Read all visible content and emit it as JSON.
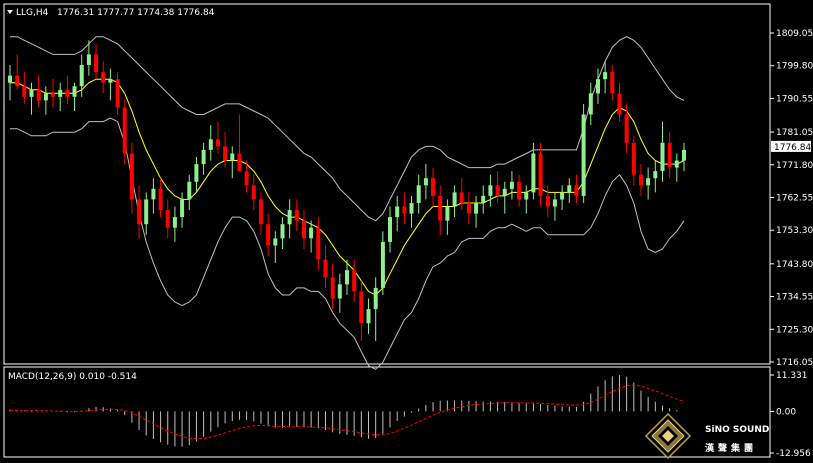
{
  "header": {
    "symbol_text": "LLG,H4",
    "ohlc_text": "1776.31 1777.77 1774.38 1776.84"
  },
  "macd": {
    "label": "MACD(12,26,9) 0.010 -0.514",
    "axis_labels": [
      "11.331",
      "0.00",
      "-12.956"
    ]
  },
  "logo": {
    "en": "SiNO SOUND",
    "cn": "漢聲集團"
  },
  "colors": {
    "background": "#000000",
    "frame": "#ffffff",
    "bull": "#90ee90",
    "bear": "#ff0000",
    "ma": "#ffff00",
    "bands": "#c0c0c0",
    "signal": "#ff0000",
    "hist": "#c0c0c0"
  },
  "chart_data": {
    "type": "candlestick",
    "y_ticks": [
      1809.05,
      1799.8,
      1790.55,
      1781.05,
      1771.8,
      1762.55,
      1753.3,
      1743.8,
      1734.55,
      1725.3,
      1716.05
    ],
    "current_price": 1776.84,
    "ylim": [
      1716.05,
      1809.05
    ],
    "candles": [
      [
        1795,
        1800,
        1790,
        1797
      ],
      [
        1797,
        1803,
        1793,
        1794
      ],
      [
        1794,
        1798,
        1789,
        1791
      ],
      [
        1791,
        1795,
        1786,
        1793
      ],
      [
        1793,
        1797,
        1788,
        1790
      ],
      [
        1790,
        1794,
        1786,
        1792
      ],
      [
        1792,
        1796,
        1788,
        1791
      ],
      [
        1791,
        1795,
        1787,
        1793
      ],
      [
        1793,
        1797,
        1789,
        1791
      ],
      [
        1791,
        1795,
        1787,
        1794
      ],
      [
        1794,
        1803,
        1791,
        1800
      ],
      [
        1800,
        1807,
        1797,
        1803
      ],
      [
        1803,
        1806,
        1796,
        1798
      ],
      [
        1798,
        1801,
        1792,
        1795
      ],
      [
        1795,
        1799,
        1790,
        1796
      ],
      [
        1796,
        1798,
        1786,
        1788
      ],
      [
        1788,
        1790,
        1772,
        1775
      ],
      [
        1775,
        1778,
        1758,
        1762
      ],
      [
        1762,
        1766,
        1751,
        1755
      ],
      [
        1755,
        1764,
        1752,
        1762
      ],
      [
        1762,
        1768,
        1758,
        1765
      ],
      [
        1765,
        1768,
        1757,
        1759
      ],
      [
        1759,
        1762,
        1751,
        1754
      ],
      [
        1754,
        1760,
        1750,
        1757
      ],
      [
        1757,
        1764,
        1754,
        1762
      ],
      [
        1762,
        1769,
        1759,
        1767
      ],
      [
        1767,
        1774,
        1764,
        1772
      ],
      [
        1772,
        1778,
        1769,
        1776
      ],
      [
        1776,
        1783,
        1773,
        1779
      ],
      [
        1779,
        1784,
        1775,
        1777
      ],
      [
        1777,
        1781,
        1771,
        1773
      ],
      [
        1773,
        1777,
        1768,
        1775
      ],
      [
        1775,
        1786,
        1772,
        1770
      ],
      [
        1770,
        1773,
        1764,
        1766
      ],
      [
        1766,
        1769,
        1759,
        1762
      ],
      [
        1762,
        1764,
        1752,
        1755
      ],
      [
        1755,
        1758,
        1746,
        1749
      ],
      [
        1749,
        1753,
        1744,
        1751
      ],
      [
        1751,
        1757,
        1748,
        1755
      ],
      [
        1755,
        1762,
        1751,
        1759
      ],
      [
        1759,
        1762,
        1753,
        1756
      ],
      [
        1756,
        1759,
        1748,
        1751
      ],
      [
        1751,
        1756,
        1747,
        1754
      ],
      [
        1754,
        1757,
        1742,
        1745
      ],
      [
        1745,
        1749,
        1737,
        1740
      ],
      [
        1740,
        1744,
        1731,
        1734
      ],
      [
        1734,
        1741,
        1730,
        1738
      ],
      [
        1738,
        1745,
        1735,
        1742
      ],
      [
        1742,
        1745,
        1733,
        1736
      ],
      [
        1736,
        1739,
        1722,
        1727
      ],
      [
        1727,
        1734,
        1724,
        1731
      ],
      [
        1731,
        1740,
        1722,
        1737
      ],
      [
        1737,
        1753,
        1735,
        1750
      ],
      [
        1750,
        1760,
        1747,
        1757
      ],
      [
        1757,
        1763,
        1753,
        1760
      ],
      [
        1760,
        1764,
        1755,
        1758
      ],
      [
        1758,
        1763,
        1754,
        1761
      ],
      [
        1761,
        1769,
        1758,
        1766
      ],
      [
        1766,
        1772,
        1762,
        1768
      ],
      [
        1768,
        1771,
        1760,
        1763
      ],
      [
        1763,
        1766,
        1752,
        1756
      ],
      [
        1756,
        1762,
        1752,
        1760
      ],
      [
        1760,
        1766,
        1757,
        1764
      ],
      [
        1764,
        1768,
        1759,
        1761
      ],
      [
        1761,
        1764,
        1755,
        1758
      ],
      [
        1758,
        1763,
        1754,
        1761
      ],
      [
        1761,
        1766,
        1758,
        1763
      ],
      [
        1763,
        1769,
        1760,
        1766
      ],
      [
        1766,
        1770,
        1761,
        1763
      ],
      [
        1763,
        1767,
        1758,
        1765
      ],
      [
        1765,
        1770,
        1762,
        1767
      ],
      [
        1767,
        1769,
        1760,
        1762
      ],
      [
        1762,
        1766,
        1758,
        1764
      ],
      [
        1764,
        1778,
        1762,
        1775
      ],
      [
        1775,
        1778,
        1760,
        1763
      ],
      [
        1763,
        1766,
        1757,
        1760
      ],
      [
        1760,
        1764,
        1756,
        1762
      ],
      [
        1762,
        1766,
        1759,
        1764
      ],
      [
        1764,
        1768,
        1761,
        1766
      ],
      [
        1766,
        1769,
        1761,
        1763
      ],
      [
        1763,
        1789,
        1761,
        1786
      ],
      [
        1786,
        1795,
        1783,
        1792
      ],
      [
        1792,
        1799,
        1789,
        1796
      ],
      [
        1796,
        1801,
        1792,
        1798
      ],
      [
        1798,
        1800,
        1790,
        1792
      ],
      [
        1792,
        1795,
        1784,
        1786
      ],
      [
        1786,
        1789,
        1775,
        1778
      ],
      [
        1778,
        1780,
        1766,
        1769
      ],
      [
        1769,
        1772,
        1763,
        1766
      ],
      [
        1766,
        1771,
        1762,
        1768
      ],
      [
        1768,
        1773,
        1764,
        1770
      ],
      [
        1770,
        1784,
        1767,
        1778
      ],
      [
        1778,
        1781,
        1768,
        1771
      ],
      [
        1771,
        1775,
        1767,
        1773
      ],
      [
        1773,
        1778,
        1770,
        1776
      ]
    ],
    "ma": [
      1795,
      1795,
      1794,
      1793,
      1793,
      1792,
      1792,
      1792,
      1792,
      1792,
      1793,
      1795,
      1796,
      1796,
      1796,
      1795,
      1792,
      1787,
      1781,
      1776,
      1772,
      1768,
      1765,
      1763,
      1762,
      1762,
      1764,
      1767,
      1770,
      1772,
      1773,
      1773,
      1773,
      1772,
      1770,
      1767,
      1763,
      1760,
      1758,
      1757,
      1757,
      1756,
      1755,
      1754,
      1752,
      1749,
      1746,
      1744,
      1742,
      1739,
      1736,
      1735,
      1737,
      1741,
      1745,
      1749,
      1752,
      1755,
      1758,
      1760,
      1760,
      1760,
      1760,
      1761,
      1761,
      1761,
      1761,
      1762,
      1763,
      1763,
      1764,
      1764,
      1764,
      1765,
      1765,
      1764,
      1764,
      1764,
      1764,
      1764,
      1767,
      1772,
      1777,
      1782,
      1786,
      1788,
      1787,
      1784,
      1779,
      1775,
      1773,
      1772,
      1772,
      1772,
      1773
    ],
    "upper": [
      1808,
      1808,
      1807,
      1806,
      1805,
      1804,
      1803,
      1803,
      1803,
      1803,
      1804,
      1806,
      1808,
      1808,
      1807,
      1806,
      1804,
      1802,
      1800,
      1798,
      1796,
      1794,
      1792,
      1790,
      1788,
      1787,
      1786,
      1786,
      1787,
      1788,
      1789,
      1789,
      1789,
      1788,
      1787,
      1786,
      1785,
      1783,
      1781,
      1779,
      1777,
      1775,
      1774,
      1772,
      1770,
      1768,
      1765,
      1763,
      1761,
      1759,
      1757,
      1756,
      1758,
      1762,
      1766,
      1770,
      1774,
      1776,
      1777,
      1777,
      1776,
      1774,
      1773,
      1772,
      1771,
      1771,
      1771,
      1771,
      1772,
      1772,
      1773,
      1774,
      1775,
      1776,
      1776,
      1776,
      1776,
      1776,
      1776,
      1776,
      1782,
      1790,
      1796,
      1801,
      1805,
      1807,
      1808,
      1807,
      1805,
      1802,
      1799,
      1796,
      1793,
      1791,
      1790
    ],
    "lower": [
      1782,
      1782,
      1781,
      1780,
      1780,
      1780,
      1781,
      1781,
      1781,
      1781,
      1782,
      1784,
      1784,
      1784,
      1785,
      1784,
      1778,
      1768,
      1758,
      1750,
      1744,
      1739,
      1735,
      1733,
      1732,
      1733,
      1735,
      1740,
      1745,
      1750,
      1754,
      1757,
      1757,
      1756,
      1753,
      1748,
      1741,
      1737,
      1735,
      1735,
      1737,
      1737,
      1736,
      1736,
      1734,
      1730,
      1727,
      1725,
      1723,
      1719,
      1715,
      1714,
      1716,
      1720,
      1724,
      1728,
      1730,
      1734,
      1739,
      1743,
      1744,
      1746,
      1747,
      1750,
      1751,
      1751,
      1751,
      1753,
      1754,
      1754,
      1755,
      1754,
      1753,
      1754,
      1754,
      1752,
      1752,
      1752,
      1752,
      1752,
      1752,
      1754,
      1758,
      1763,
      1767,
      1769,
      1766,
      1761,
      1753,
      1748,
      1747,
      1748,
      1751,
      1753,
      1756
    ],
    "macd_hist": [
      0.5,
      0.4,
      0.3,
      0.2,
      0.1,
      0.0,
      -0.1,
      -0.2,
      -0.3,
      -0.3,
      0.2,
      1.0,
      1.4,
      1.3,
      1.0,
      0.4,
      -1.2,
      -3.5,
      -5.8,
      -7.5,
      -8.6,
      -9.6,
      -10.4,
      -10.9,
      -11.0,
      -10.5,
      -9.4,
      -7.9,
      -6.3,
      -4.9,
      -3.7,
      -3.0,
      -2.6,
      -2.7,
      -3.1,
      -3.8,
      -4.6,
      -5.0,
      -5.1,
      -4.9,
      -4.8,
      -4.9,
      -5.0,
      -5.3,
      -5.8,
      -6.5,
      -7.0,
      -7.3,
      -7.6,
      -8.1,
      -8.5,
      -8.3,
      -7.0,
      -5.0,
      -3.0,
      -1.6,
      -0.4,
      0.9,
      2.0,
      2.9,
      3.3,
      3.4,
      3.4,
      3.4,
      3.3,
      3.2,
      3.1,
      3.1,
      3.0,
      2.9,
      2.8,
      2.6,
      2.5,
      2.4,
      2.3,
      2.0,
      1.8,
      1.6,
      1.5,
      1.4,
      3.0,
      5.5,
      7.8,
      9.7,
      10.9,
      11.3,
      10.8,
      9.0,
      6.5,
      4.5,
      3.0,
      1.8,
      1.0,
      0.4,
      0.0
    ],
    "macd_signal": [
      0.3,
      0.3,
      0.3,
      0.3,
      0.2,
      0.2,
      0.1,
      0.1,
      0.0,
      0.0,
      0.0,
      0.2,
      0.4,
      0.6,
      0.7,
      0.6,
      0.3,
      -0.4,
      -1.5,
      -2.7,
      -3.9,
      -5.0,
      -6.1,
      -7.0,
      -7.8,
      -8.3,
      -8.5,
      -8.4,
      -8.0,
      -7.4,
      -6.7,
      -6.0,
      -5.3,
      -4.8,
      -4.5,
      -4.4,
      -4.5,
      -4.6,
      -4.7,
      -4.8,
      -4.8,
      -4.8,
      -4.9,
      -5.0,
      -5.1,
      -5.4,
      -5.7,
      -6.0,
      -6.3,
      -6.7,
      -7.0,
      -7.3,
      -7.3,
      -6.9,
      -6.1,
      -5.2,
      -4.3,
      -3.2,
      -2.2,
      -1.2,
      -0.3,
      0.4,
      1.0,
      1.5,
      1.9,
      2.1,
      2.3,
      2.5,
      2.6,
      2.7,
      2.7,
      2.7,
      2.6,
      2.6,
      2.5,
      2.4,
      2.3,
      2.1,
      2.0,
      1.9,
      2.1,
      2.8,
      3.8,
      5.0,
      6.2,
      7.2,
      8.0,
      8.2,
      7.9,
      7.2,
      6.4,
      5.5,
      4.6,
      3.8,
      3.1
    ],
    "macd_ylim": [
      -12.956,
      11.331
    ]
  }
}
